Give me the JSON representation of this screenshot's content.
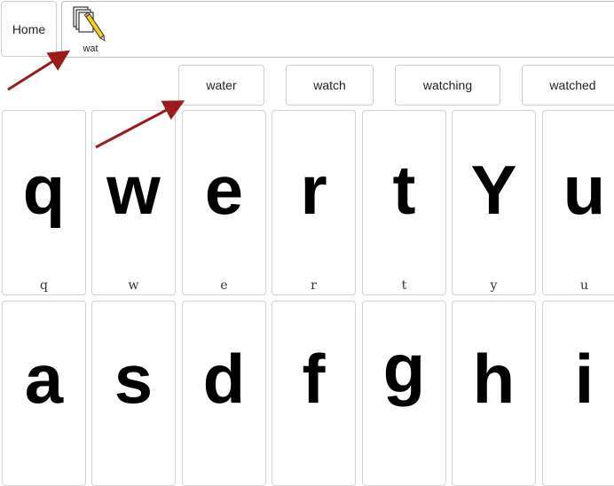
{
  "toolbar": {
    "home_label": "Home"
  },
  "message": {
    "symbol_label": "wat",
    "symbol_icon": "pencil-on-pages-icon"
  },
  "predictions": [
    "water",
    "watch",
    "watching",
    "watched"
  ],
  "keyboard": {
    "row1": [
      {
        "glyph": "q",
        "label": "q"
      },
      {
        "glyph": "w",
        "label": "w"
      },
      {
        "glyph": "e",
        "label": "e"
      },
      {
        "glyph": "r",
        "label": "r"
      },
      {
        "glyph": "t",
        "label": "t"
      },
      {
        "glyph": "Y",
        "label": "y"
      },
      {
        "glyph": "u",
        "label": "u"
      }
    ],
    "row2": [
      {
        "glyph": "a",
        "label": ""
      },
      {
        "glyph": "s",
        "label": ""
      },
      {
        "glyph": "d",
        "label": ""
      },
      {
        "glyph": "f",
        "label": ""
      },
      {
        "glyph": "g",
        "label": ""
      },
      {
        "glyph": "h",
        "label": ""
      },
      {
        "glyph": "i",
        "label": ""
      }
    ]
  },
  "colors": {
    "annotation_arrow": "#9b1b1b",
    "key_border": "#d2d2d2"
  }
}
